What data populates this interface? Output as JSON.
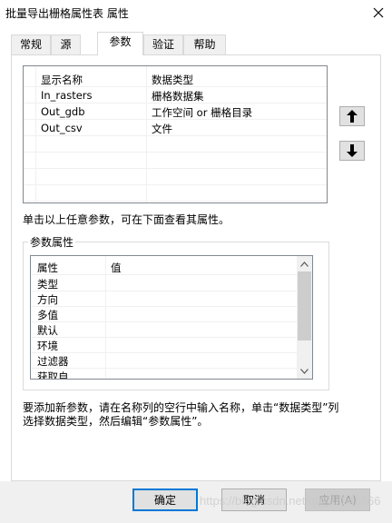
{
  "window": {
    "title": "批量导出栅格属性表 属性"
  },
  "tabs": [
    {
      "label": "常规"
    },
    {
      "label": "源"
    },
    {
      "label": "参数"
    },
    {
      "label": "验证"
    },
    {
      "label": "帮助"
    }
  ],
  "params": {
    "columns": [
      "显示名称",
      "数据类型"
    ],
    "rows": [
      {
        "name": "In_rasters",
        "type": "栅格数据集"
      },
      {
        "name": "Out_gdb",
        "type": "工作空间 or 栅格目录"
      },
      {
        "name": "Out_csv",
        "type": "文件"
      }
    ]
  },
  "hint_select": "单击以上任意参数，可在下面查看其属性。",
  "param_props": {
    "group_label": "参数属性",
    "columns": [
      "属性",
      "值"
    ],
    "rows": [
      "类型",
      "方向",
      "多值",
      "默认",
      "环境",
      "过滤器",
      "获取自"
    ]
  },
  "hint_add": "要添加新参数，请在名称列的空行中输入名称，单击“数据类型”列选择数据类型，然后编辑“参数属性”。",
  "buttons": {
    "ok": "确定",
    "cancel": "取消",
    "apply": "应用(A)"
  },
  "watermark": "https://blog.csdn.net/qq_37548866"
}
